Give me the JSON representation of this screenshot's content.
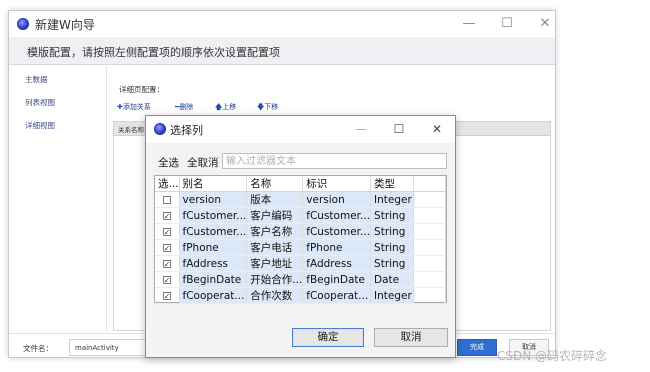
{
  "wizard": {
    "title": "新建W向导",
    "controls": {
      "minimize": "—",
      "maximize": "☐",
      "close": "✕"
    },
    "header": "模版配置，请按照左侧配置项的顺序依次设置配置项",
    "nav_items": [
      "主数据",
      "列表视图",
      "详细视图"
    ],
    "detail_label": "详细页配置：",
    "toolbar": {
      "add": {
        "symbol": "✚",
        "label": "添加关系"
      },
      "delete": {
        "symbol": "━",
        "label": "删除"
      },
      "up": {
        "symbol": "🡅",
        "label": "上移"
      },
      "down": {
        "symbol": "🡇",
        "label": "下移"
      }
    },
    "grid_header": "关系名称",
    "footer": {
      "file_label": "文件名：",
      "file_value": "mainActivity",
      "finish": "完成",
      "cancel": "取消"
    }
  },
  "dialog": {
    "title": "选择列",
    "controls": {
      "minimize": "—",
      "maximize": "☐",
      "close": "✕"
    },
    "select_all": "全选",
    "deselect_all": "全取消",
    "filter_placeholder": "输入过滤器文本",
    "columns": [
      "选...",
      "别名",
      "名称",
      "标识",
      "类型"
    ],
    "rows": [
      {
        "checked": false,
        "alias": "version",
        "name": "版本",
        "id": "version",
        "type": "Integer"
      },
      {
        "checked": true,
        "alias": "fCustomer...",
        "name": "客户编码",
        "id": "fCustomer...",
        "type": "String"
      },
      {
        "checked": true,
        "alias": "fCustomer...",
        "name": "客户名称",
        "id": "fCustomer...",
        "type": "String"
      },
      {
        "checked": true,
        "alias": "fPhone",
        "name": "客户电话",
        "id": "fPhone",
        "type": "String"
      },
      {
        "checked": true,
        "alias": "fAddress",
        "name": "客户地址",
        "id": "fAddress",
        "type": "String"
      },
      {
        "checked": true,
        "alias": "fBeginDate",
        "name": "开始合作...",
        "id": "fBeginDate",
        "type": "Date"
      },
      {
        "checked": true,
        "alias": "fCooperat...",
        "name": "合作次数",
        "id": "fCooperat...",
        "type": "Integer"
      }
    ],
    "ok": "确定",
    "cancel": "取消"
  },
  "watermark": "CSDN @码农碎碎念",
  "colors": {
    "accent": "#2f6fcf",
    "selected_row": "#dce8f7",
    "nav_text": "#3b4a88"
  }
}
